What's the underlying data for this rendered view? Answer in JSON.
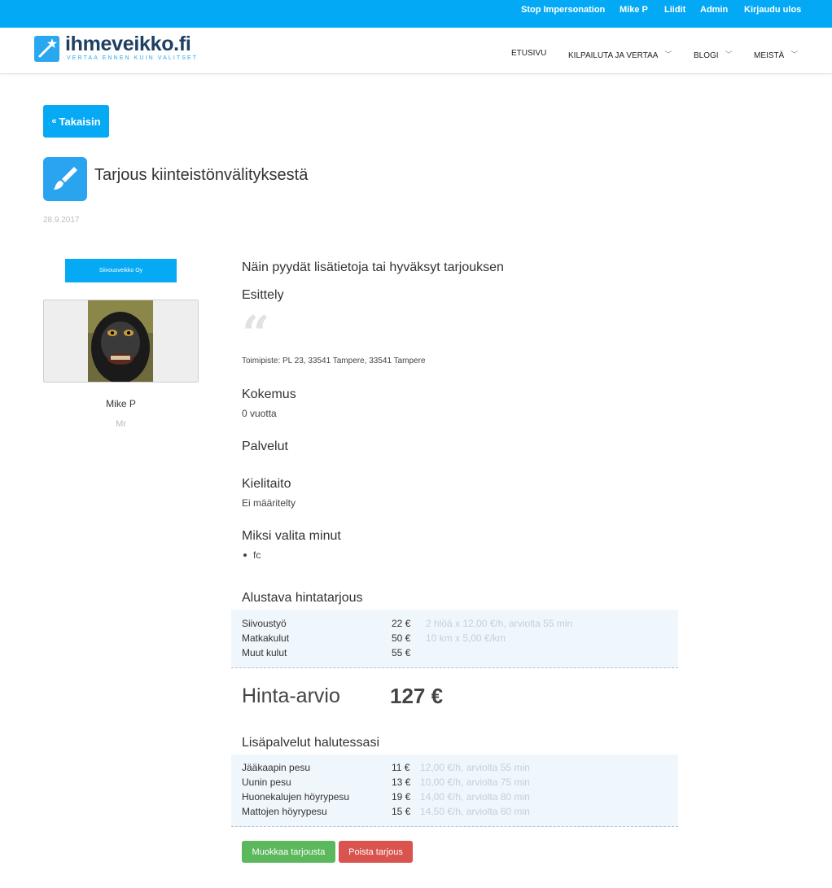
{
  "topbar": {
    "items": [
      "Stop Impersonation",
      "Mike P",
      "Liidit",
      "Admin",
      "Kirjaudu ulos"
    ]
  },
  "header": {
    "logo_text": "ihmeveikko.fi",
    "logo_sub": "VERTAA ENNEN KUIN VALITSET",
    "nav": [
      {
        "label": "ETUSIVU",
        "dropdown": false
      },
      {
        "label": "KILPAILUTA JA VERTAA",
        "dropdown": true
      },
      {
        "label": "BLOGI",
        "dropdown": true
      },
      {
        "label": "MEISTÄ",
        "dropdown": true
      }
    ]
  },
  "back_button": "Takaisin",
  "page": {
    "title": "Tarjous kiinteistönvälityksestä",
    "date": "28.9.2017"
  },
  "profile": {
    "company": "Siivousveikko Oy",
    "name": "Mike P",
    "title": "Mr"
  },
  "offer": {
    "lead": "Näin pyydät lisätietoja tai hyväksyt tarjouksen",
    "intro_heading": "Esittely",
    "office": "Toimipiste: PL 23, 33541 Tampere, 33541 Tampere",
    "experience_heading": "Kokemus",
    "experience_value": "0 vuotta",
    "services_heading": "Palvelut",
    "languages_heading": "Kielitaito",
    "languages_value": "Ei määritelty",
    "why_heading": "Miksi valita minut",
    "why_items": [
      "fc"
    ]
  },
  "pricing": {
    "heading": "Alustava hintatarjous",
    "rows": [
      {
        "label": "Siivoustyö",
        "amount": "22 €",
        "note": "2 hlöä x 12,00 €/h, arviolta 55 min"
      },
      {
        "label": "Matkakulut",
        "amount": "50 €",
        "note": "10 km x 5,00 €/km"
      },
      {
        "label": "Muut kulut",
        "amount": "55 €",
        "note": ""
      }
    ],
    "estimate_label": "Hinta-arvio",
    "estimate_value": "127 €"
  },
  "extras": {
    "heading": "Lisäpalvelut halutessasi",
    "rows": [
      {
        "label": "Jääkaapin pesu",
        "amount": "11 €",
        "note": "12,00 €/h, arviolta 55 min"
      },
      {
        "label": "Uunin pesu",
        "amount": "13 €",
        "note": "10,00 €/h, arviolta 75 min"
      },
      {
        "label": "Huonekalujen höyrypesu",
        "amount": "19 €",
        "note": "14,00 €/h, arviolta 80 min"
      },
      {
        "label": "Mattojen höyrypesu",
        "amount": "15 €",
        "note": "14,50 €/h, arviolta 60 min"
      }
    ]
  },
  "actions": {
    "edit": "Muokkaa tarjousta",
    "delete": "Poista tarjous"
  },
  "colors": {
    "primary": "#05a9f4",
    "logo_dark": "#1f3f62",
    "success": "#5cb85c",
    "danger": "#d9534f",
    "price_bg": "#eff6fc"
  }
}
